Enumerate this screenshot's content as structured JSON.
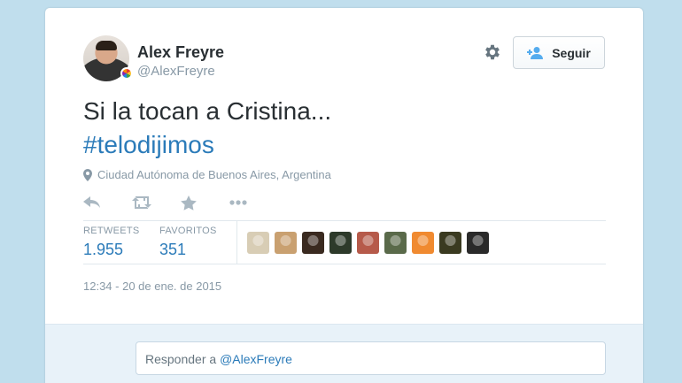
{
  "user": {
    "name": "Alex Freyre",
    "handle": "@AlexFreyre"
  },
  "follow_button": {
    "label": "Seguir"
  },
  "tweet": {
    "text": "Si la tocan a Cristina...",
    "hashtag": "#telodijimos",
    "location": "Ciudad Autónoma de Buenos Aires, Argentina",
    "timestamp": "12:34 - 20 de ene. de 2015"
  },
  "actions": [
    "reply-icon",
    "retweet-icon",
    "favorite-star-icon",
    "more-icon"
  ],
  "stats": {
    "retweets_label": "RETWEETS",
    "retweets_value": "1.955",
    "favorites_label": "FAVORITOS",
    "favorites_value": "351"
  },
  "reply": {
    "prefix": "Responder a ",
    "mention": "@AlexFreyre"
  },
  "colors": {
    "background": "#c0deed",
    "link": "#2b7bb9",
    "text": "#292f33",
    "muted": "#8899a6"
  },
  "faces": [
    "#d8cdb5",
    "#c9a070",
    "#3a2a20",
    "#2d3a2a",
    "#b65a4a",
    "#5a6a4a",
    "#f08a30",
    "#3a3a20",
    "#2a2a2a"
  ]
}
